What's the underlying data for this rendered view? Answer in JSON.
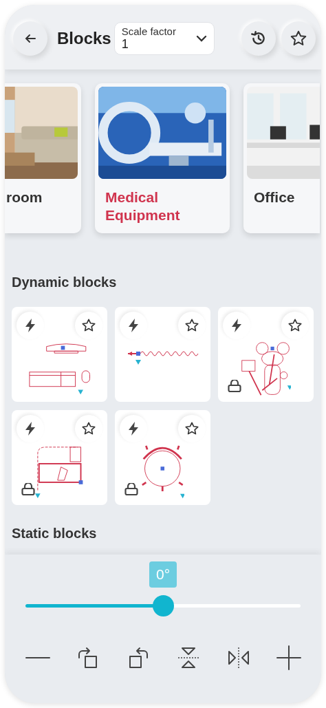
{
  "header": {
    "title": "Blocks",
    "scale_field": {
      "label": "Scale factor",
      "value": "1"
    }
  },
  "categories": [
    {
      "label": "room",
      "selected": false,
      "kind": "livingroom"
    },
    {
      "label": "Medical Equipment",
      "selected": true,
      "kind": "hospital"
    },
    {
      "label": "Office",
      "selected": false,
      "kind": "office"
    }
  ],
  "dynamic_blocks": {
    "title": "Dynamic blocks",
    "items": [
      {
        "locked": false
      },
      {
        "locked": false
      },
      {
        "locked": true
      },
      {
        "locked": true
      },
      {
        "locked": true
      }
    ]
  },
  "static_blocks": {
    "title": "Static blocks"
  },
  "rotation": {
    "reading": "0°",
    "level": 0.5
  }
}
